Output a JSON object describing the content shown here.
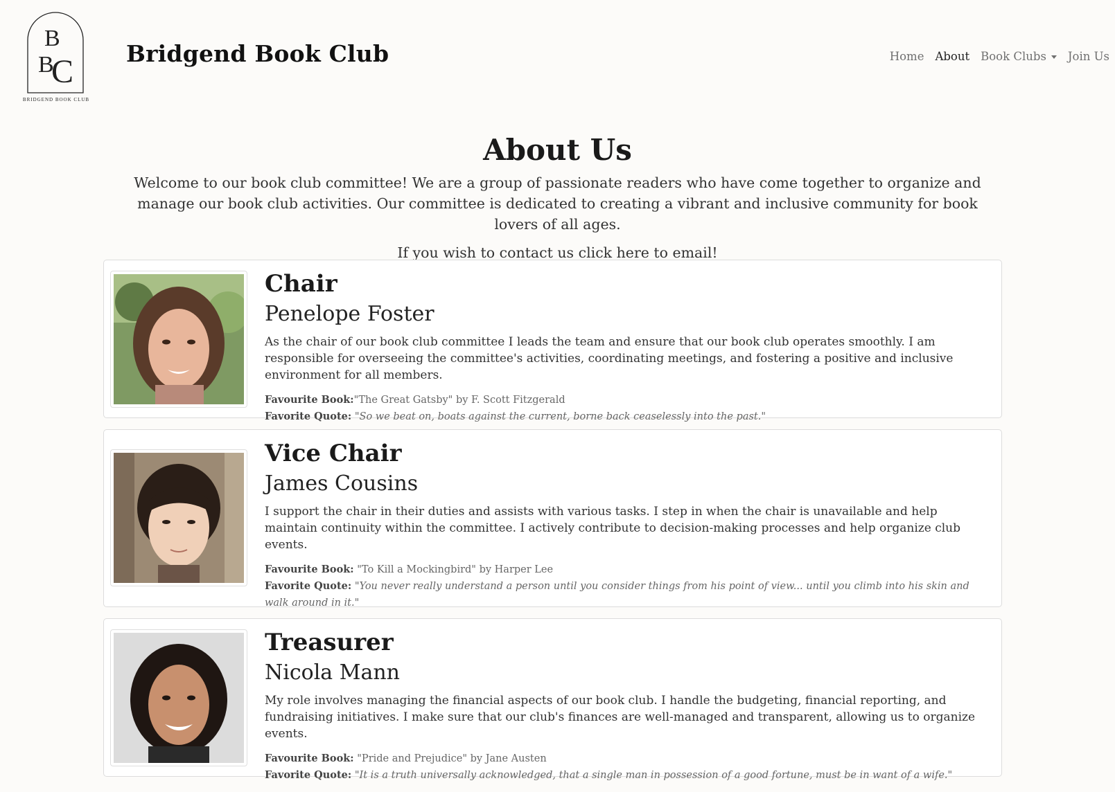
{
  "brand": {
    "title": "Bridgend Book Club",
    "logo_text": "BRIDGEND BOOK CLUB",
    "logo_letters": "BBC"
  },
  "nav": {
    "home": "Home",
    "about": "About",
    "book_clubs": "Book Clubs",
    "join": "Join Us"
  },
  "about": {
    "title": "About Us",
    "intro": "Welcome to our book club committee! We are a group of passionate readers who have come together to organize and manage our book club activities. Our committee is dedicated to creating a vibrant and inclusive community for book lovers of all ages.",
    "contact_prefix": "If you wish to contact us ",
    "contact_link": "click here to email!"
  },
  "members": [
    {
      "role": "Chair",
      "name": "Penelope Foster",
      "bio": "As the chair of our book club committee I leads the team and ensure that our book club operates smoothly. I am responsible for overseeing the committee's activities, coordinating meetings, and fostering a positive and inclusive environment for all members.",
      "book_label": "Favourite Book:",
      "book": "\"The Great Gatsby\" by F. Scott Fitzgerald",
      "quote_label": "Favorite Quote:",
      "quote": "\"So we beat on, boats against the current, borne back ceaselessly into the past.\""
    },
    {
      "role": "Vice Chair",
      "name": "James Cousins",
      "bio": "I support the chair in their duties and assists with various tasks. I step in when the chair is unavailable and help maintain continuity within the committee. I actively contribute to decision-making processes and help organize club events.",
      "book_label": "Favourite Book:",
      "book": "\"To Kill a Mockingbird\" by Harper Lee",
      "quote_label": "Favorite Quote:",
      "quote": "\"You never really understand a person until you consider things from his point of view... until you climb into his skin and walk around in it.\""
    },
    {
      "role": "Treasurer",
      "name": "Nicola Mann",
      "bio": "My role involves managing the financial aspects of our book club. I handle the budgeting, financial reporting, and fundraising initiatives. I make sure that our club's finances are well-managed and transparent, allowing us to organize events.",
      "book_label": "Favourite Book:",
      "book": "\"Pride and Prejudice\" by Jane Austen",
      "quote_label": "Favorite Quote:",
      "quote": "\"It is a truth universally acknowledged, that a single man in possession of a good fortune, must be in want of a wife.\""
    }
  ]
}
